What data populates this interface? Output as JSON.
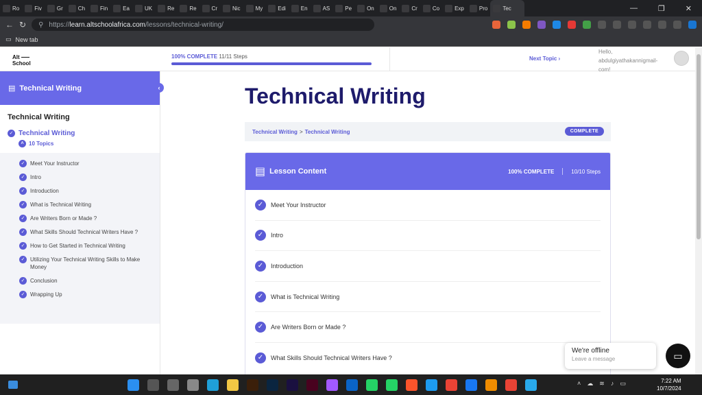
{
  "browser": {
    "tabs": [
      "Ro",
      "Fiv",
      "Gr",
      "Ch",
      "Fin",
      "Ea",
      "UK",
      "Re",
      "Re",
      "Cr",
      "Nic",
      "My",
      "Edi",
      "En",
      "AS",
      "Pe",
      "On",
      "On",
      "Cr",
      "Co",
      "Exp",
      "Pro",
      "Tec"
    ],
    "active_tab": "Tec",
    "url_scheme": "https://",
    "url_host": "learn.altschoolafrica.com",
    "url_path": "/lessons/technical-writing/",
    "bookmark": "New tab",
    "window_controls": [
      "—",
      "❐",
      "✕"
    ]
  },
  "header": {
    "logo_line1": "Alt",
    "logo_line2": "School",
    "progress_percent_label": "100% COMPLETE",
    "progress_steps": "11/11 Steps",
    "progress_fraction": 1.0,
    "next_topic": "Next Topic",
    "greeting": "Hello, abdulgiyathakannigmail-com!"
  },
  "sidebar": {
    "header_title": "Technical Writing",
    "course_title": "Technical Writing",
    "lesson_title": "Technical Writing",
    "topics_count": "10 Topics",
    "topics": [
      "Meet Your Instructor",
      "Intro",
      "Introduction",
      "What is Technical Writing",
      "Are Writers Born or Made ?",
      "What Skills Should Technical Writers Have ?",
      "How to Get Started in Technical Writing",
      "Utilizing Your Technical Writing Skills to Make Money",
      "Conclusion",
      "Wrapping Up"
    ]
  },
  "main": {
    "title": "Technical Writing",
    "breadcrumb_1": "Technical Writing",
    "breadcrumb_sep": ">",
    "breadcrumb_2": "Technical Writing",
    "status_badge": "COMPLETE",
    "lesson_content_title": "Lesson Content",
    "lesson_complete": "100% COMPLETE",
    "lesson_steps": "10/10 Steps",
    "lessons": [
      "Meet Your Instructor",
      "Intro",
      "Introduction",
      "What is Technical Writing",
      "Are Writers Born or Made ?",
      "What Skills Should Technical Writers Have ?"
    ]
  },
  "chat": {
    "status": "We're offline",
    "prompt": "Leave a message"
  },
  "taskbar": {
    "time": "7:22 AM",
    "date": "10/7/2024"
  },
  "colors": {
    "accent": "#6969e8",
    "title": "#1e1b6b"
  }
}
